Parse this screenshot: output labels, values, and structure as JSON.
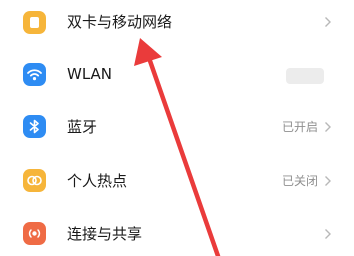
{
  "settings": {
    "items": [
      {
        "label": "双卡与移动网络",
        "status": "",
        "icon": "sim-card-icon",
        "color": "#f6b53a"
      },
      {
        "label": "WLAN",
        "status": "",
        "icon": "wifi-icon",
        "color": "#2e8cf3"
      },
      {
        "label": "蓝牙",
        "status": "已开启",
        "icon": "bluetooth-icon",
        "color": "#2e8cf3"
      },
      {
        "label": "个人热点",
        "status": "已关闭",
        "icon": "hotspot-icon",
        "color": "#f6b53a"
      },
      {
        "label": "连接与共享",
        "status": "",
        "icon": "share-icon",
        "color": "#ef6b45"
      }
    ]
  },
  "annotation": {
    "arrow_color": "#ea3b3b"
  }
}
